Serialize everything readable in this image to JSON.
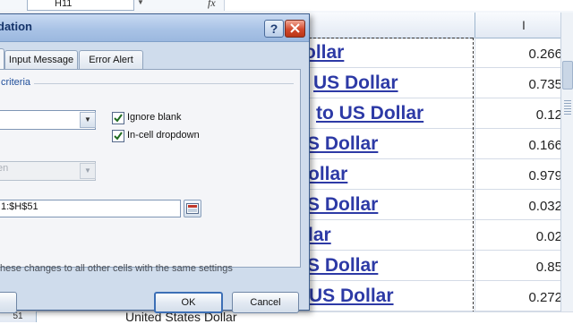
{
  "formula_bar": {
    "name_box": "H11",
    "fx_label": "fx"
  },
  "grid": {
    "column_header": "I",
    "rows": [
      {
        "link": "ollar",
        "value": "0.266"
      },
      {
        "link": "US Dollar",
        "value": "0.735"
      },
      {
        "link": "to US Dollar",
        "value": "0.12"
      },
      {
        "link": "S Dollar",
        "value": "0.166"
      },
      {
        "link": "ollar",
        "value": "0.979"
      },
      {
        "link": "S Dollar",
        "value": "0.032"
      },
      {
        "link": "lar",
        "value": "0.02"
      },
      {
        "link": "S Dollar",
        "value": "0.85"
      },
      {
        "link": "US Dollar",
        "value": "0.272"
      }
    ],
    "bottom_row_number": "51",
    "bottom_cell_text": "United States Dollar"
  },
  "dialog": {
    "title": "dation",
    "help_label": "?",
    "tabs": {
      "settings": "",
      "input_message": "Input Message",
      "error_alert": "Error Alert"
    },
    "criteria_label": "criteria",
    "allow_value": "",
    "ignore_blank_label": "Ignore blank",
    "ignore_blank_checked": true,
    "in_cell_dropdown_label": "In-cell dropdown",
    "in_cell_dropdown_checked": true,
    "data_value": "en",
    "source_value": "1:$H$51",
    "apply_text": "these changes to all other cells with the same settings",
    "ok_label": "OK",
    "cancel_label": "Cancel",
    "clear_label": ""
  },
  "colors": {
    "link": "#2d3aa6",
    "title_bar": "#a9c3e6",
    "close_button": "#d2482c",
    "ok_border": "#3c6fb6"
  }
}
